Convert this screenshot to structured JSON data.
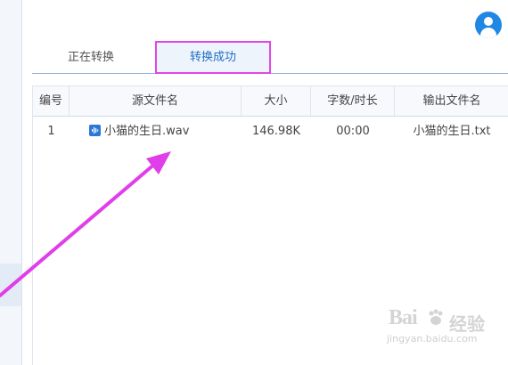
{
  "tabs": [
    {
      "label": "正在转换",
      "active": false
    },
    {
      "label": "转换成功",
      "active": true
    }
  ],
  "table": {
    "headers": [
      "编号",
      "源文件名",
      "大小",
      "字数/时长",
      "输出文件名"
    ],
    "rows": [
      {
        "index": "1",
        "source": "小猫的生日.wav",
        "size": "146.98K",
        "duration": "00:00",
        "output": "小猫的生日.txt"
      }
    ]
  },
  "watermark": {
    "brand": "Bai",
    "brand_cn": "经验",
    "url": "jingyan.baidu.com"
  },
  "colors": {
    "accent": "#1f88e5",
    "highlight_border": "#e246e6",
    "arrow": "#e03ee8"
  },
  "icons": {
    "avatar": "user-avatar-icon",
    "file": "audio-file-icon"
  }
}
